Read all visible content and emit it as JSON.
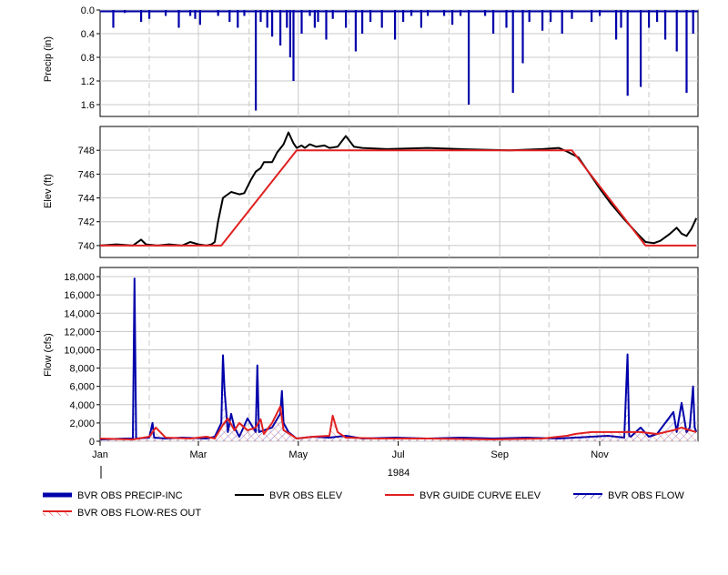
{
  "chart_data": [
    {
      "type": "bar",
      "panel": "precip",
      "ylabel": "Precip (in)",
      "ylim": [
        0,
        1.8
      ],
      "inverted": true,
      "yticks": [
        0.0,
        0.4,
        0.8,
        1.2,
        1.6
      ],
      "ytick_labels": [
        "0.0",
        "0.4",
        "0.8",
        "1.2",
        "1.6"
      ],
      "grid": true,
      "series": [
        {
          "name": "BVR OBS PRECIP-INC",
          "color": "#0000aa",
          "x": [
            8,
            15,
            25,
            30,
            40,
            48,
            55,
            58,
            61,
            72,
            79,
            84,
            88,
            95,
            98,
            102,
            105,
            110,
            114,
            116,
            118,
            123,
            128,
            131,
            133,
            138,
            142,
            150,
            156,
            160,
            165,
            172,
            180,
            185,
            190,
            196,
            200,
            210,
            215,
            220,
            225,
            235,
            240,
            248,
            252,
            258,
            262,
            270,
            275,
            282,
            288,
            300,
            305,
            315,
            318,
            322,
            330,
            335,
            340,
            345,
            352,
            358,
            362
          ],
          "values": [
            0.3,
            0.05,
            0.2,
            0.15,
            0.1,
            0.3,
            0.1,
            0.15,
            0.25,
            0.1,
            0.2,
            0.3,
            0.1,
            1.7,
            0.2,
            0.3,
            0.45,
            0.6,
            0.3,
            0.8,
            1.2,
            0.4,
            0.1,
            0.3,
            0.2,
            0.5,
            0.15,
            0.3,
            0.7,
            0.4,
            0.2,
            0.3,
            0.5,
            0.2,
            0.1,
            0.3,
            0.1,
            0.1,
            0.25,
            0.1,
            1.6,
            0.1,
            0.4,
            0.3,
            1.4,
            0.9,
            0.2,
            0.35,
            0.2,
            0.4,
            0.15,
            0.2,
            0.1,
            0.5,
            0.3,
            1.45,
            1.3,
            0.3,
            0.2,
            0.5,
            0.7,
            1.4,
            0.4
          ]
        }
      ]
    },
    {
      "type": "line",
      "panel": "elev",
      "ylabel": "Elev (ft)",
      "ylim": [
        739,
        750
      ],
      "yticks": [
        740,
        742,
        744,
        746,
        748
      ],
      "ytick_labels": [
        "740",
        "742",
        "744",
        "746",
        "748"
      ],
      "grid": true,
      "series": [
        {
          "name": "BVR OBS ELEV",
          "color": "#000000",
          "x": [
            0,
            10,
            20,
            25,
            28,
            35,
            42,
            50,
            55,
            60,
            65,
            68,
            70,
            72,
            75,
            80,
            85,
            88,
            92,
            95,
            98,
            100,
            105,
            108,
            112,
            115,
            118,
            120,
            123,
            125,
            128,
            132,
            137,
            140,
            145,
            150,
            155,
            160,
            175,
            200,
            220,
            250,
            270,
            280,
            285,
            292,
            298,
            305,
            312,
            320,
            328,
            333,
            338,
            342,
            348,
            352,
            355,
            358,
            361,
            364
          ],
          "values": [
            740.0,
            740.1,
            740.0,
            740.5,
            740.1,
            740.0,
            740.1,
            740.0,
            740.3,
            740.1,
            740.0,
            740.1,
            740.3,
            742.0,
            744.0,
            744.5,
            744.3,
            744.4,
            745.5,
            746.2,
            746.5,
            747.0,
            747.0,
            747.8,
            748.5,
            749.5,
            748.6,
            748.2,
            748.4,
            748.2,
            748.5,
            748.3,
            748.4,
            748.2,
            748.3,
            749.2,
            748.3,
            748.2,
            748.1,
            748.2,
            748.1,
            748.0,
            748.1,
            748.2,
            747.9,
            747.4,
            746.2,
            744.8,
            743.5,
            742.2,
            741.0,
            740.3,
            740.2,
            740.4,
            741.0,
            741.5,
            741.0,
            740.8,
            741.4,
            742.3
          ]
        },
        {
          "name": "BVR GUIDE CURVE ELEV",
          "color": "#e02020",
          "x": [
            0,
            74,
            120,
            288,
            333,
            364
          ],
          "values": [
            740.0,
            740.0,
            748.0,
            748.0,
            740.0,
            740.0
          ]
        }
      ]
    },
    {
      "type": "line",
      "panel": "flow",
      "ylabel": "Flow (cfs)",
      "ylim": [
        0,
        19000
      ],
      "yticks": [
        0,
        2000,
        4000,
        6000,
        8000,
        10000,
        12000,
        14000,
        16000,
        18000
      ],
      "ytick_labels": [
        "0",
        "2,000",
        "4,000",
        "6,000",
        "8,000",
        "10,000",
        "12,000",
        "14,000",
        "16,000",
        "18,000"
      ],
      "grid": true,
      "x_tick_labels": [
        "Jan",
        "Mar",
        "May",
        "Jul",
        "Sep",
        "Nov"
      ],
      "x_ticks": [
        0,
        60,
        121,
        182,
        244,
        305
      ],
      "year_label": "1984",
      "series": [
        {
          "name": "BVR OBS FLOW",
          "color": "#0000aa",
          "x": [
            0,
            15,
            20,
            21,
            22,
            30,
            32,
            33,
            40,
            50,
            65,
            70,
            74,
            75,
            76,
            78,
            80,
            82,
            85,
            90,
            95,
            96,
            97,
            100,
            105,
            110,
            111,
            112,
            115,
            120,
            130,
            140,
            150,
            160,
            180,
            200,
            220,
            240,
            260,
            280,
            300,
            310,
            320,
            322,
            323,
            324,
            330,
            335,
            340,
            350,
            352,
            355,
            358,
            360,
            362,
            363,
            364
          ],
          "values": [
            200,
            300,
            300,
            17800,
            300,
            400,
            2000,
            400,
            300,
            400,
            300,
            500,
            2000,
            9400,
            5500,
            1000,
            3000,
            1500,
            500,
            2500,
            1000,
            8300,
            1000,
            1200,
            1500,
            3000,
            5500,
            2000,
            1000,
            300,
            500,
            400,
            600,
            300,
            400,
            300,
            400,
            300,
            400,
            300,
            500,
            600,
            400,
            9500,
            600,
            500,
            1500,
            500,
            800,
            3200,
            1000,
            4200,
            1000,
            1500,
            6000,
            1500,
            1000
          ]
        },
        {
          "name": "BVR OBS FLOW-RES OUT",
          "color": "#e02020",
          "x": [
            0,
            20,
            30,
            34,
            40,
            55,
            65,
            70,
            75,
            78,
            82,
            85,
            90,
            95,
            98,
            100,
            105,
            110,
            112,
            115,
            120,
            130,
            140,
            142,
            145,
            150,
            170,
            200,
            240,
            270,
            285,
            290,
            300,
            310,
            320,
            330,
            340,
            350,
            355,
            360,
            364
          ],
          "values": [
            300,
            200,
            500,
            1500,
            400,
            300,
            500,
            300,
            1800,
            2500,
            1200,
            2000,
            1200,
            1500,
            2400,
            800,
            2000,
            3800,
            1200,
            900,
            300,
            500,
            600,
            2800,
            1000,
            400,
            300,
            300,
            200,
            300,
            600,
            800,
            1000,
            1000,
            1000,
            1000,
            800,
            1200,
            1500,
            1200,
            1000
          ]
        }
      ]
    }
  ],
  "legend": [
    {
      "label": "BVR OBS PRECIP-INC",
      "color": "#0000aa",
      "style": "thick"
    },
    {
      "label": "BVR OBS ELEV",
      "color": "#000000",
      "style": "line"
    },
    {
      "label": "BVR GUIDE CURVE ELEV",
      "color": "#e02020",
      "style": "line"
    },
    {
      "label": "BVR OBS FLOW",
      "color": "#0000aa",
      "style": "hatch"
    },
    {
      "label": "BVR OBS FLOW-RES OUT",
      "color": "#e02020",
      "style": "hatch"
    }
  ]
}
